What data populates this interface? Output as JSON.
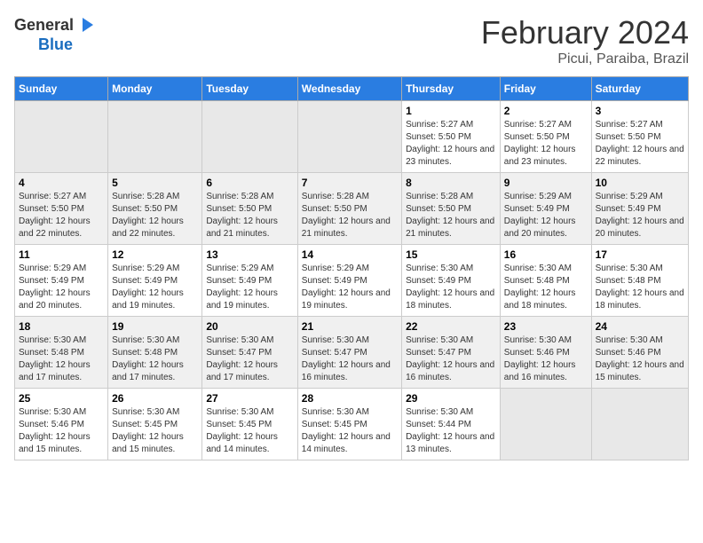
{
  "logo": {
    "general": "General",
    "blue": "Blue"
  },
  "title": "February 2024",
  "subtitle": "Picui, Paraiba, Brazil",
  "days_of_week": [
    "Sunday",
    "Monday",
    "Tuesday",
    "Wednesday",
    "Thursday",
    "Friday",
    "Saturday"
  ],
  "weeks": [
    [
      {
        "day": "",
        "empty": true
      },
      {
        "day": "",
        "empty": true
      },
      {
        "day": "",
        "empty": true
      },
      {
        "day": "",
        "empty": true
      },
      {
        "day": "1",
        "sunrise": "5:27 AM",
        "sunset": "5:50 PM",
        "daylight": "12 hours and 23 minutes."
      },
      {
        "day": "2",
        "sunrise": "5:27 AM",
        "sunset": "5:50 PM",
        "daylight": "12 hours and 23 minutes."
      },
      {
        "day": "3",
        "sunrise": "5:27 AM",
        "sunset": "5:50 PM",
        "daylight": "12 hours and 22 minutes."
      }
    ],
    [
      {
        "day": "4",
        "sunrise": "5:27 AM",
        "sunset": "5:50 PM",
        "daylight": "12 hours and 22 minutes."
      },
      {
        "day": "5",
        "sunrise": "5:28 AM",
        "sunset": "5:50 PM",
        "daylight": "12 hours and 22 minutes."
      },
      {
        "day": "6",
        "sunrise": "5:28 AM",
        "sunset": "5:50 PM",
        "daylight": "12 hours and 21 minutes."
      },
      {
        "day": "7",
        "sunrise": "5:28 AM",
        "sunset": "5:50 PM",
        "daylight": "12 hours and 21 minutes."
      },
      {
        "day": "8",
        "sunrise": "5:28 AM",
        "sunset": "5:50 PM",
        "daylight": "12 hours and 21 minutes."
      },
      {
        "day": "9",
        "sunrise": "5:29 AM",
        "sunset": "5:49 PM",
        "daylight": "12 hours and 20 minutes."
      },
      {
        "day": "10",
        "sunrise": "5:29 AM",
        "sunset": "5:49 PM",
        "daylight": "12 hours and 20 minutes."
      }
    ],
    [
      {
        "day": "11",
        "sunrise": "5:29 AM",
        "sunset": "5:49 PM",
        "daylight": "12 hours and 20 minutes."
      },
      {
        "day": "12",
        "sunrise": "5:29 AM",
        "sunset": "5:49 PM",
        "daylight": "12 hours and 19 minutes."
      },
      {
        "day": "13",
        "sunrise": "5:29 AM",
        "sunset": "5:49 PM",
        "daylight": "12 hours and 19 minutes."
      },
      {
        "day": "14",
        "sunrise": "5:29 AM",
        "sunset": "5:49 PM",
        "daylight": "12 hours and 19 minutes."
      },
      {
        "day": "15",
        "sunrise": "5:30 AM",
        "sunset": "5:49 PM",
        "daylight": "12 hours and 18 minutes."
      },
      {
        "day": "16",
        "sunrise": "5:30 AM",
        "sunset": "5:48 PM",
        "daylight": "12 hours and 18 minutes."
      },
      {
        "day": "17",
        "sunrise": "5:30 AM",
        "sunset": "5:48 PM",
        "daylight": "12 hours and 18 minutes."
      }
    ],
    [
      {
        "day": "18",
        "sunrise": "5:30 AM",
        "sunset": "5:48 PM",
        "daylight": "12 hours and 17 minutes."
      },
      {
        "day": "19",
        "sunrise": "5:30 AM",
        "sunset": "5:48 PM",
        "daylight": "12 hours and 17 minutes."
      },
      {
        "day": "20",
        "sunrise": "5:30 AM",
        "sunset": "5:47 PM",
        "daylight": "12 hours and 17 minutes."
      },
      {
        "day": "21",
        "sunrise": "5:30 AM",
        "sunset": "5:47 PM",
        "daylight": "12 hours and 16 minutes."
      },
      {
        "day": "22",
        "sunrise": "5:30 AM",
        "sunset": "5:47 PM",
        "daylight": "12 hours and 16 minutes."
      },
      {
        "day": "23",
        "sunrise": "5:30 AM",
        "sunset": "5:46 PM",
        "daylight": "12 hours and 16 minutes."
      },
      {
        "day": "24",
        "sunrise": "5:30 AM",
        "sunset": "5:46 PM",
        "daylight": "12 hours and 15 minutes."
      }
    ],
    [
      {
        "day": "25",
        "sunrise": "5:30 AM",
        "sunset": "5:46 PM",
        "daylight": "12 hours and 15 minutes."
      },
      {
        "day": "26",
        "sunrise": "5:30 AM",
        "sunset": "5:45 PM",
        "daylight": "12 hours and 15 minutes."
      },
      {
        "day": "27",
        "sunrise": "5:30 AM",
        "sunset": "5:45 PM",
        "daylight": "12 hours and 14 minutes."
      },
      {
        "day": "28",
        "sunrise": "5:30 AM",
        "sunset": "5:45 PM",
        "daylight": "12 hours and 14 minutes."
      },
      {
        "day": "29",
        "sunrise": "5:30 AM",
        "sunset": "5:44 PM",
        "daylight": "12 hours and 13 minutes."
      },
      {
        "day": "",
        "empty": true
      },
      {
        "day": "",
        "empty": true
      }
    ]
  ],
  "labels": {
    "sunrise": "Sunrise:",
    "sunset": "Sunset:",
    "daylight": "Daylight:"
  }
}
